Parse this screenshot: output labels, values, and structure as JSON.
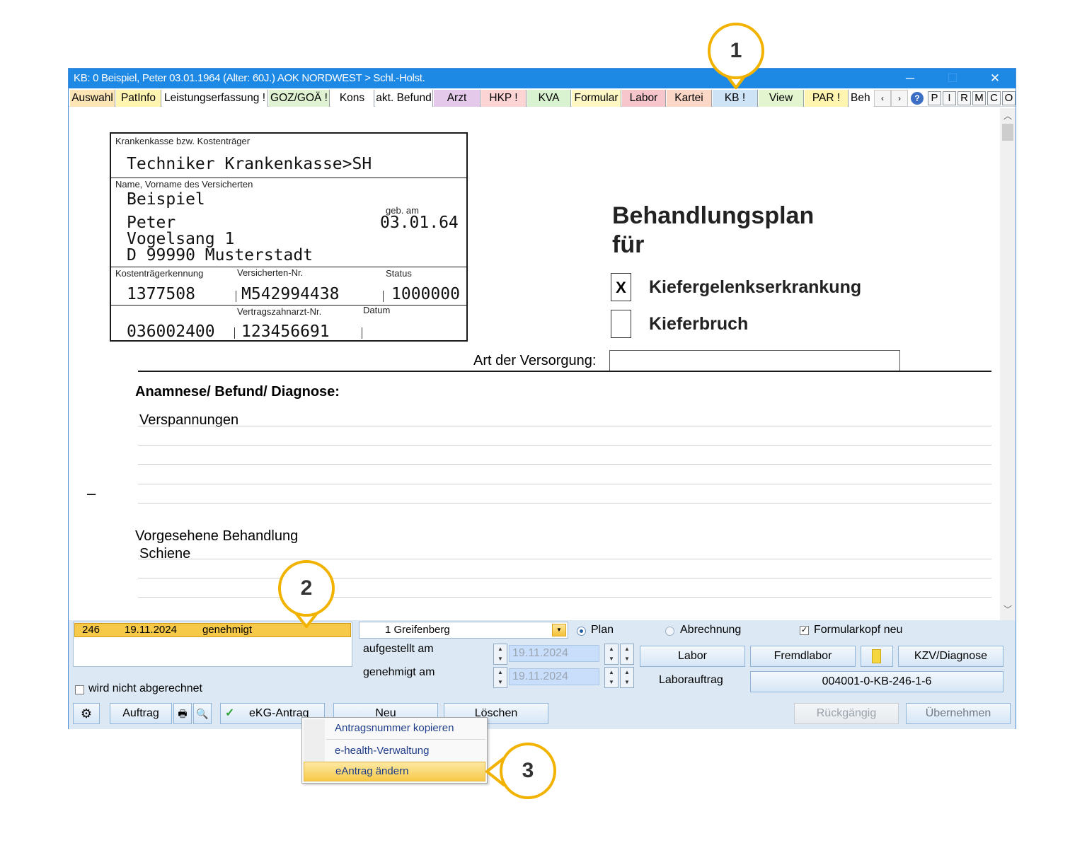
{
  "window": {
    "title": "KB: 0  Beispiel, Peter  03.01.1964 (Alter: 60J.)  AOK NORDWEST > Schl.-Holst.",
    "minimize": "─",
    "maximize": "☐",
    "close": "✕"
  },
  "tabs": [
    {
      "label": "Auswahl",
      "color": "#fde5b5"
    },
    {
      "label": "PatInfo",
      "color": "#fff4b0"
    },
    {
      "label": "Leistungserfassung !",
      "color": "#ffffff"
    },
    {
      "label": "GOZ/GOÄ !",
      "color": "#dff3d2"
    },
    {
      "label": "Kons",
      "color": "#ffffff"
    },
    {
      "label": "akt. Befund",
      "color": "#ffffff"
    },
    {
      "label": "Arzt",
      "color": "#e4c9ea"
    },
    {
      "label": "HKP !",
      "color": "#fcd4d4"
    },
    {
      "label": "KVA",
      "color": "#d9f2d0"
    },
    {
      "label": "Formular",
      "color": "#fff7c4"
    },
    {
      "label": "Labor",
      "color": "#f6c6cc"
    },
    {
      "label": "Kartei",
      "color": "#fbd7c7"
    },
    {
      "label": "KB !",
      "color": "#cfe3f7"
    },
    {
      "label": "View",
      "color": "#e2f5cf"
    },
    {
      "label": "PAR !",
      "color": "#fff4b0"
    },
    {
      "label": "Beh",
      "color": "#ffffff"
    }
  ],
  "tab_scroll": {
    "left": "‹",
    "right": "›"
  },
  "tab_help": "?",
  "side_buttons": [
    "P",
    "I",
    "R",
    "M",
    "C",
    "O"
  ],
  "address": {
    "kasse_label": "Krankenkasse bzw. Kostenträger",
    "kasse_value": "Techniker Krankenkasse>SH",
    "name_label": "Name, Vorname des Versicherten",
    "surname": "Beispiel",
    "firstname": "Peter",
    "street": "Vogelsang 1",
    "city": "D 99990 Musterstadt",
    "dob_label": "geb. am",
    "dob": "03.01.64",
    "kt_kennung_label": "Kostenträgerkennung",
    "kt_kennung": "1377508",
    "vers_nr_label": "Versicherten-Nr.",
    "vers_nr": "M542994438",
    "status_label": "Status",
    "status": "1000000",
    "vz_nr_label": "Vertragszahnarzt-Nr.",
    "vz_nr": "123456691",
    "bsnr": "036002400",
    "datum_label": "Datum"
  },
  "form": {
    "heading_1": "Behandlungsplan",
    "heading_2": "für",
    "check_1_mark": "X",
    "check_1_label": "Kiefergelenkserkrankung",
    "check_2_mark": "",
    "check_2_label": "Kieferbruch",
    "versorgung_label": "Art der Versorgung:",
    "versorgung_value": "",
    "anamnese_label": "Anamnese/ Befund/ Diagnose:",
    "anamnese_value": "Verspannungen",
    "behandlung_label": "Vorgesehene Behandlung",
    "behandlung_value": "Schiene",
    "dash": "–"
  },
  "scroll": {
    "up": "︿",
    "down": "﹀"
  },
  "bottom": {
    "list_row": {
      "nr": "246",
      "date": "19.11.2024",
      "status": "genehmigt"
    },
    "not_billed_label": "wird nicht abgerechnet",
    "practice_select": "1 Greifenberg",
    "plan_label": "Plan",
    "abrechnung_label": "Abrechnung",
    "formularkopf_label": "Formularkopf neu",
    "formularkopf_mark": "✓",
    "aufgestellt_label": "aufgestellt am",
    "aufgestellt_value": "19.11.2024",
    "genehmigt_label": "genehmigt am",
    "genehmigt_value": "19.11.2024",
    "labor_btn": "Labor",
    "fremdlabor_btn": "Fremdlabor",
    "kzv_btn": "KZV/Diagnose",
    "laborauftrag_label": "Laborauftrag",
    "antragsnummer": "004001-0-KB-246-1-6"
  },
  "toolbar": {
    "auftrag": "Auftrag",
    "ekg": "eKG-Antrag",
    "neu": "Neu",
    "loeschen": "Löschen",
    "rueckgaengig": "Rückgängig",
    "uebernehmen": "Übernehmen",
    "check": "✓"
  },
  "menu": {
    "items": [
      "Antragsnummer kopieren",
      "e-health-Verwaltung",
      "eAntrag ändern"
    ]
  },
  "callouts": [
    "1",
    "2",
    "3"
  ],
  "colors": {
    "titlebar": "#1e88e5",
    "highlight": "#f7c948",
    "callout_ring": "#f2b300",
    "bottom_panel": "#dce9f5"
  }
}
